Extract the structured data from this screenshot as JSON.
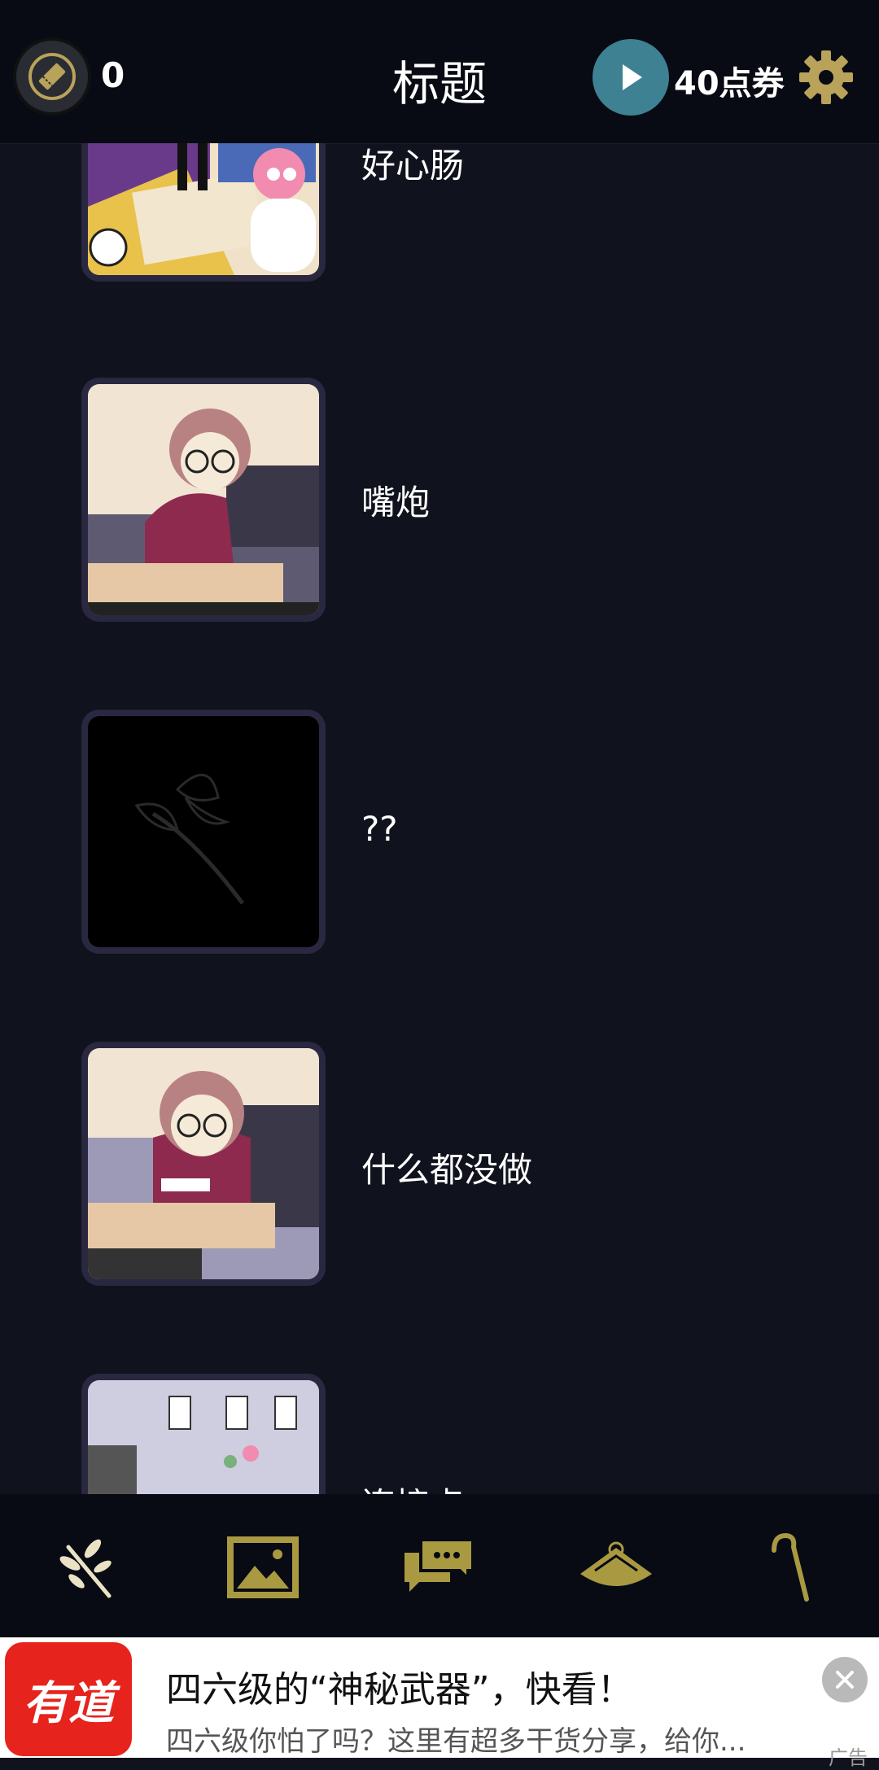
{
  "header": {
    "ticket_count": "0",
    "title": "标题",
    "coupons": "40点券"
  },
  "items": [
    {
      "label": "好心肠"
    },
    {
      "label": "嘴炮"
    },
    {
      "label": "??"
    },
    {
      "label": "什么都没做"
    },
    {
      "label": "连接点"
    }
  ],
  "bottom_nav": [
    {
      "icon": "branch-icon"
    },
    {
      "icon": "gallery-icon"
    },
    {
      "icon": "chat-icon"
    },
    {
      "icon": "hat-icon"
    },
    {
      "icon": "cane-icon"
    }
  ],
  "ad": {
    "logo_text": "有道",
    "title": "四六级的“神秘武器”，快看！",
    "description": "四六级你怕了吗？这里有超多干货分享，给你...",
    "tag": "广告"
  },
  "colors": {
    "background": "#10131d",
    "header": "#080b13",
    "accent_gold": "#b9a25a",
    "nav_olive": "#a99a42",
    "play_teal": "#3e8193"
  }
}
